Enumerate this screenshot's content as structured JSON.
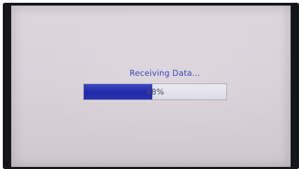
{
  "status": {
    "message": "Receiving Data..."
  },
  "progress": {
    "percent": 48,
    "label": "48%"
  },
  "colors": {
    "text_accent": "#3a3fbf",
    "bar_fill": "#1f29a8",
    "screen_bg": "#d9d2d9"
  }
}
